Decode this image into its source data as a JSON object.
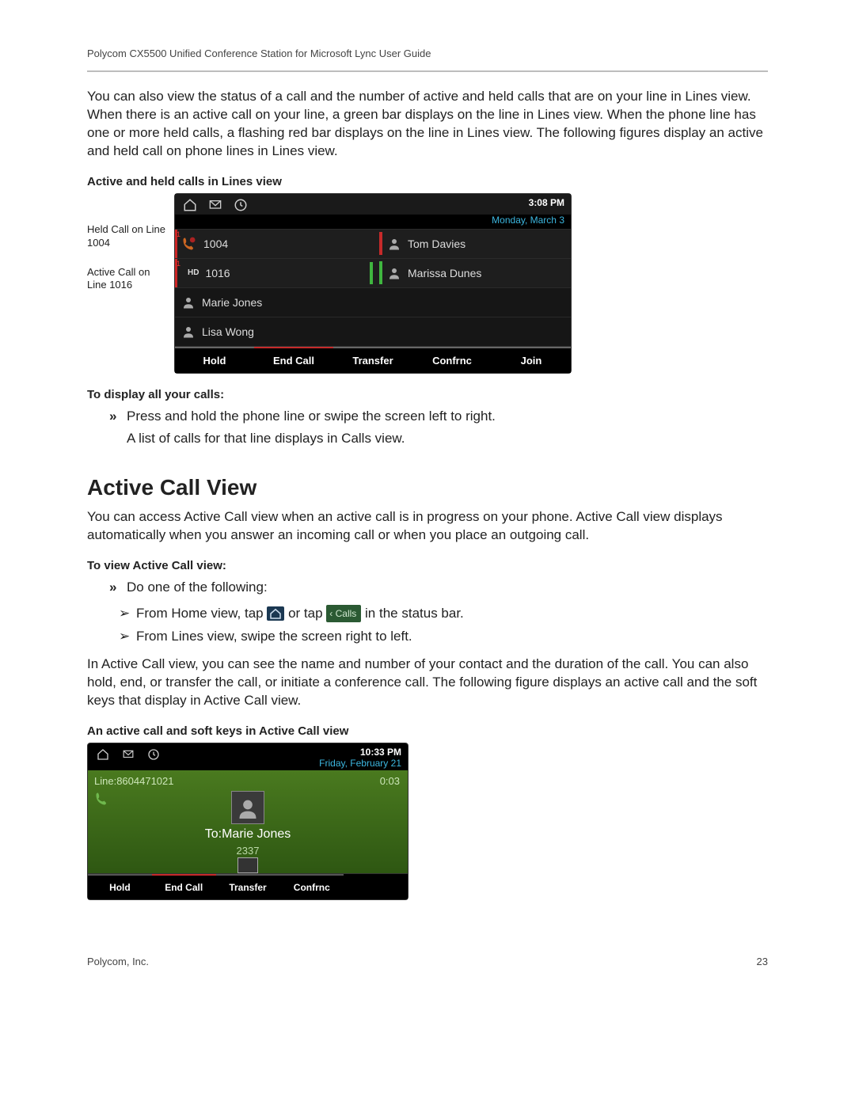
{
  "header": "Polycom CX5500 Unified Conference Station for Microsoft Lync User Guide",
  "intro_para": "You can also view the status of a call and the number of active and held calls that are on your line in Lines view. When there is an active call on your line, a green bar displays on the line in Lines view. When the phone line has one or more held calls, a flashing red bar displays on the line in Lines view. The following figures display an active and held call on phone lines in Lines view.",
  "fig1_caption": "Active and held calls in Lines view",
  "labels": {
    "held": "Held Call on Line 1004",
    "active": "Active Call on Line 1016"
  },
  "shot1": {
    "time": "3:08 PM",
    "date": "Monday, March 3",
    "left_rows": [
      {
        "text": "1004",
        "held": true
      },
      {
        "text": "1016",
        "hd": true
      },
      {
        "text": "Marie Jones",
        "person": true
      },
      {
        "text": "Lisa Wong",
        "person": true
      }
    ],
    "right_rows": [
      {
        "text": "Tom Davies",
        "person": true
      },
      {
        "text": "Marissa Dunes",
        "person": true,
        "green": true
      }
    ],
    "softkeys": [
      "Hold",
      "End Call",
      "Transfer",
      "Confrnc",
      "Join"
    ]
  },
  "display_calls_heading": "To display all your calls:",
  "display_calls_bullet": "Press and hold the phone line or swipe the screen left to right.",
  "display_calls_sub": "A list of calls for that line displays in Calls view.",
  "section_title": "Active Call View",
  "section_para": "You can access Active Call view when an active call is in progress on your phone. Active Call view displays automatically when you answer an incoming call or when you place an outgoing call.",
  "view_heading": "To view Active Call view:",
  "view_bullet": "Do one of the following:",
  "view_arrow1_pre": "From Home view, tap",
  "view_arrow1_mid": " or tap ",
  "view_arrow1_calls": "‹ Calls",
  "view_arrow1_post": " in the status bar.",
  "view_arrow2": "From Lines view, swipe the screen right to left.",
  "view_para2": "In Active Call view, you can see the name and number of your contact and the duration of the call. You can also hold, end, or transfer the call, or initiate a conference call. The following figure displays an active call and the soft keys that display in Active Call view.",
  "fig2_caption": "An active call and soft keys in Active Call view",
  "shot2": {
    "time": "10:33 PM",
    "date": "Friday, February 21",
    "line": "Line:8604471021",
    "duration": "0:03",
    "to": "To:Marie Jones",
    "number": "2337",
    "softkeys": [
      "Hold",
      "End Call",
      "Transfer",
      "Confrnc"
    ]
  },
  "footer": {
    "left": "Polycom, Inc.",
    "right": "23"
  }
}
